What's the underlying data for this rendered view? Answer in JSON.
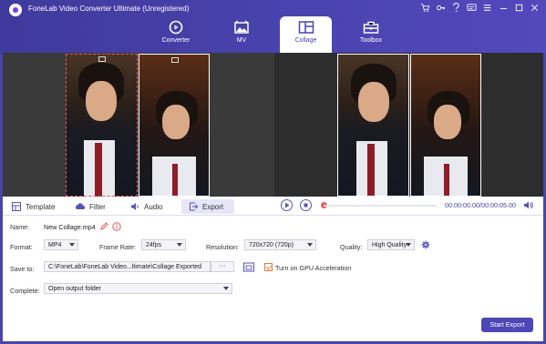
{
  "window": {
    "title": "FoneLab Video Converter Ultimate (Unregistered)"
  },
  "tabs": [
    {
      "label": "Converter",
      "icon": "converter-icon"
    },
    {
      "label": "MV",
      "icon": "mv-icon"
    },
    {
      "label": "Collage",
      "icon": "collage-icon",
      "active": true
    },
    {
      "label": "Toolbox",
      "icon": "toolbox-icon"
    }
  ],
  "editor_tabs": [
    {
      "label": "Template",
      "icon": "template-icon"
    },
    {
      "label": "Filter",
      "icon": "filter-icon"
    },
    {
      "label": "Audio",
      "icon": "audio-icon"
    },
    {
      "label": "Export",
      "icon": "export-icon",
      "active": true
    }
  ],
  "player": {
    "time": "00:00:00.00/00:00:05.00",
    "progress": 0.0
  },
  "export": {
    "name_label": "Name:",
    "name_value": "New Collage.mp4",
    "format_label": "Format:",
    "format_value": "MP4",
    "framerate_label": "Frame Rate:",
    "framerate_value": "24fps",
    "resolution_label": "Resolution:",
    "resolution_value": "720x720 (720p)",
    "quality_label": "Quality:",
    "quality_value": "High Quality",
    "saveto_label": "Save to:",
    "saveto_value": "C:\\FoneLab\\FoneLab Video...ltimate\\Collage Exported",
    "browse_label": "···",
    "gpu_label": "Turn on GPU Acceleration",
    "gpu_checked": true,
    "complete_label": "Complete:",
    "complete_value": "Open output folder",
    "start_label": "Start Export"
  },
  "colors": {
    "brand": "#4a44b0",
    "accent_red": "#e85a5a",
    "checkbox": "#e27a3a"
  }
}
